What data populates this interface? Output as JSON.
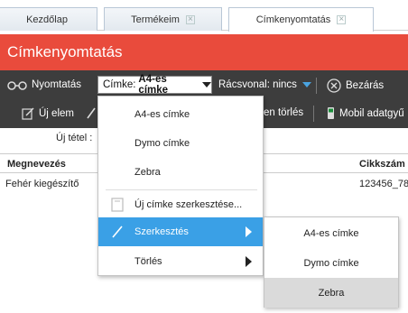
{
  "tabs": [
    {
      "label": "Kezdőlap"
    },
    {
      "label": "Termékeim"
    },
    {
      "label": "Címkenyomtatás"
    }
  ],
  "page_title": "Címkenyomtatás",
  "toolbar": {
    "print_label": "Nyomtatás",
    "label_select_prefix": "Címke:",
    "label_select_value": "A4-es címke",
    "grid_label": "Rácsvonal: nincs",
    "close_label": "Bezárás",
    "new_item_label": "Új elem",
    "delete_partial_label": "en törlés",
    "mobile_label": "Mobil adatgyű"
  },
  "new_row_label": "Új tétel :",
  "table": {
    "columns": [
      "Megnevezés",
      "Cikkszám"
    ],
    "rows": [
      {
        "name": "Fehér kiegészítő",
        "sku": "123456_78"
      }
    ]
  },
  "menu": {
    "items": [
      {
        "label": "A4-es címke"
      },
      {
        "label": "Dymo címke"
      },
      {
        "label": "Zebra"
      },
      {
        "label": "Új címke szerkesztése..."
      },
      {
        "label": "Szerkesztés"
      },
      {
        "label": "Törlés"
      }
    ]
  },
  "submenu": {
    "items": [
      {
        "label": "A4-es címke"
      },
      {
        "label": "Dymo címke"
      },
      {
        "label": "Zebra"
      }
    ]
  },
  "colors": {
    "title_bar": "#e94b3c",
    "toolbar": "#3d3d3d",
    "menu_highlight": "#3aa0e6",
    "submenu_highlight": "#dadada"
  }
}
